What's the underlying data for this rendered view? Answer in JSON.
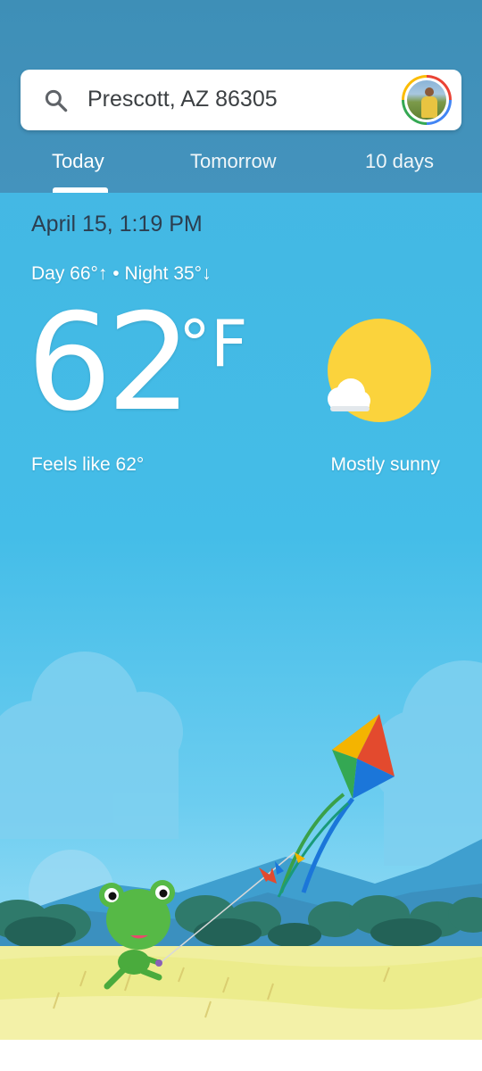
{
  "search": {
    "location": "Prescott, AZ 86305"
  },
  "tabs": [
    {
      "label": "Today",
      "selected": true
    },
    {
      "label": "Tomorrow",
      "selected": false
    },
    {
      "label": "10 days",
      "selected": false
    }
  ],
  "current": {
    "datetime": "April 15, 1:19 PM",
    "day_night": "Day 66°↑ • Night 35°↓",
    "temperature": "62",
    "unit": "°F",
    "feels_like": "Feels like 62°",
    "condition": "Mostly sunny",
    "condition_icon": "sun-with-cloud-icon"
  },
  "colors": {
    "header": "#3e8fb7",
    "sky": "#45b6e3",
    "sun": "#fbd33c"
  }
}
